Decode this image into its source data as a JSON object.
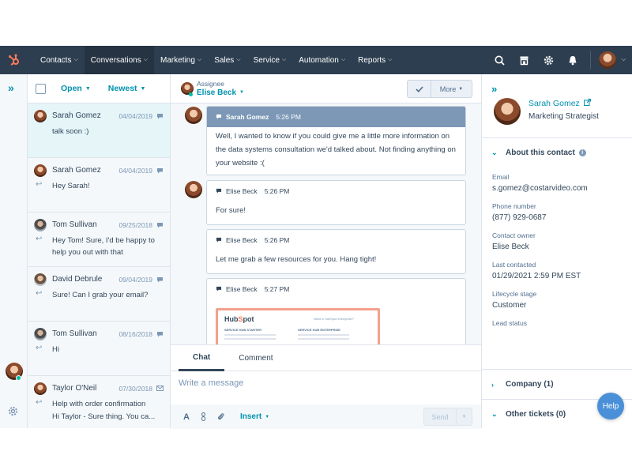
{
  "nav": {
    "items": [
      {
        "label": "Contacts",
        "active": false
      },
      {
        "label": "Conversations",
        "active": true
      },
      {
        "label": "Marketing",
        "active": false
      },
      {
        "label": "Sales",
        "active": false
      },
      {
        "label": "Service",
        "active": false
      },
      {
        "label": "Automation",
        "active": false
      },
      {
        "label": "Reports",
        "active": false
      }
    ],
    "icons": [
      "search-icon",
      "marketplace-icon",
      "settings-icon",
      "notifications-icon"
    ]
  },
  "list": {
    "filter_status": "Open",
    "filter_sort": "Newest",
    "conversations": [
      {
        "name": "Sarah Gomez",
        "date": "04/04/2019",
        "channel": "chat",
        "replied": false,
        "preview": "talk soon :)",
        "selected": true
      },
      {
        "name": "Sarah Gomez",
        "date": "04/04/2019",
        "channel": "chat",
        "replied": true,
        "preview": "Hey Sarah!",
        "selected": false
      },
      {
        "name": "Tom Sullivan",
        "date": "09/25/2018",
        "channel": "chat",
        "replied": true,
        "preview": "Hey Tom! Sure, I'd be happy to help you out with that",
        "selected": false
      },
      {
        "name": "David Debrule",
        "date": "09/04/2019",
        "channel": "chat",
        "replied": true,
        "preview": "Sure! Can I grab your email?",
        "selected": false
      },
      {
        "name": "Tom Sullivan",
        "date": "08/16/2018",
        "channel": "chat",
        "replied": true,
        "preview": "Hi",
        "selected": false
      },
      {
        "name": "Taylor O'Neil",
        "date": "07/30/2018",
        "channel": "email",
        "replied": true,
        "preview": "Help with order confirmation",
        "preview2": "Hi Taylor - Sure thing. You ca...",
        "selected": false
      }
    ]
  },
  "thread": {
    "assignee_label": "Assignee",
    "assignee_name": "Elise Beck",
    "more_label": "More",
    "messages": [
      {
        "author": "Sarah Gomez",
        "time": "5:26 PM",
        "body": "Well, I wanted to know if you could give me a little more information on the data systems consultation we'd talked about. Not finding anything on your website :(",
        "from_contact": true
      },
      {
        "author": "Elise Beck",
        "time": "5:26 PM",
        "body": "For sure!",
        "from_contact": false
      },
      {
        "author": "Elise Beck",
        "time": "5:26 PM",
        "body": "Let me grab a few resources for you. Hang tight!",
        "from_contact": false
      },
      {
        "author": "Elise Beck",
        "time": "5:27 PM",
        "body": "",
        "from_contact": false
      }
    ],
    "attachment": {
      "logo_pre": "Hub",
      "logo_o": "S",
      "logo_post": "pot",
      "small_text": "Need a HubSpot Enterprise?",
      "col1": "SERVICE HUB STARTER",
      "col2": "SERVICE HUB ENTERPRISE"
    },
    "composer": {
      "tab_chat": "Chat",
      "tab_comment": "Comment",
      "placeholder": "Write a message",
      "insert_label": "Insert",
      "send_label": "Send"
    }
  },
  "contact": {
    "name": "Sarah Gomez",
    "title": "Marketing Strategist",
    "about_label": "About this contact",
    "properties": [
      {
        "label": "Email",
        "value": "s.gomez@costarvideo.com"
      },
      {
        "label": "Phone number",
        "value": "(877) 929-0687"
      },
      {
        "label": "Contact owner",
        "value": "Elise Beck"
      },
      {
        "label": "Last contacted",
        "value": "01/29/2021 2:59 PM EST"
      },
      {
        "label": "Lifecycle stage",
        "value": "Customer"
      },
      {
        "label": "Lead status",
        "value": ""
      }
    ],
    "company_label": "Company (1)",
    "tickets_label": "Other tickets (0)"
  },
  "help_label": "Help",
  "colors": {
    "nav_bg": "#2d3e50",
    "accent": "#0091ae",
    "brand": "#ff7a59",
    "online": "#00bda5"
  }
}
